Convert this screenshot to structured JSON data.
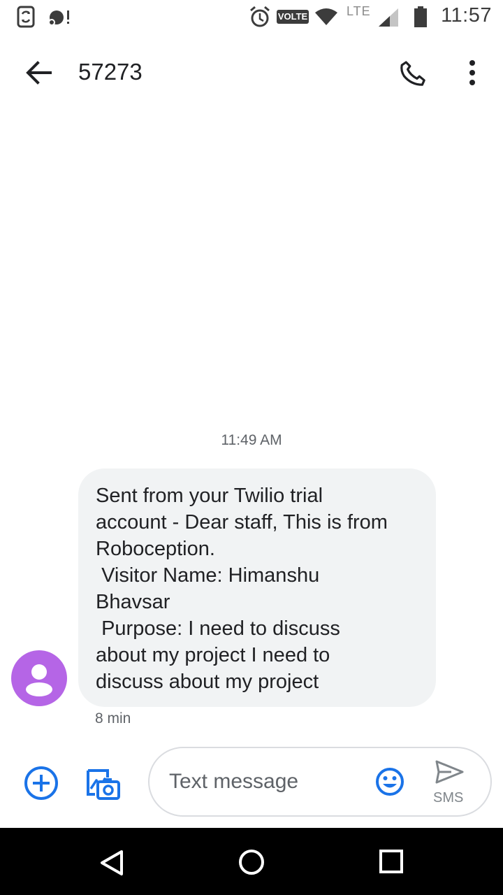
{
  "status_bar": {
    "time": "11:57",
    "volte_label": "VOLTE",
    "network_label": "LTE"
  },
  "header": {
    "title": "57273"
  },
  "conversation": {
    "timestamp": "11:49 AM",
    "message": {
      "text": "Sent from your Twilio trial\naccount - Dear staff, This is from\nRoboception.\n Visitor Name: Himanshu\nBhavsar\n Purpose: I need to discuss\nabout my project I need to\ndiscuss about my project",
      "age": "8 min"
    }
  },
  "compose": {
    "placeholder": "Text message",
    "send_label": "SMS"
  },
  "icons": {
    "back": "arrow-back-icon",
    "call": "phone-icon",
    "menu": "more-vert-icon",
    "add": "add-circle-icon",
    "gallery": "gallery-camera-icon",
    "emoji": "emoji-icon",
    "send": "send-icon"
  },
  "colors": {
    "accent": "#1a73e8",
    "bubble": "#f1f3f4",
    "avatar": "#b565e6"
  }
}
